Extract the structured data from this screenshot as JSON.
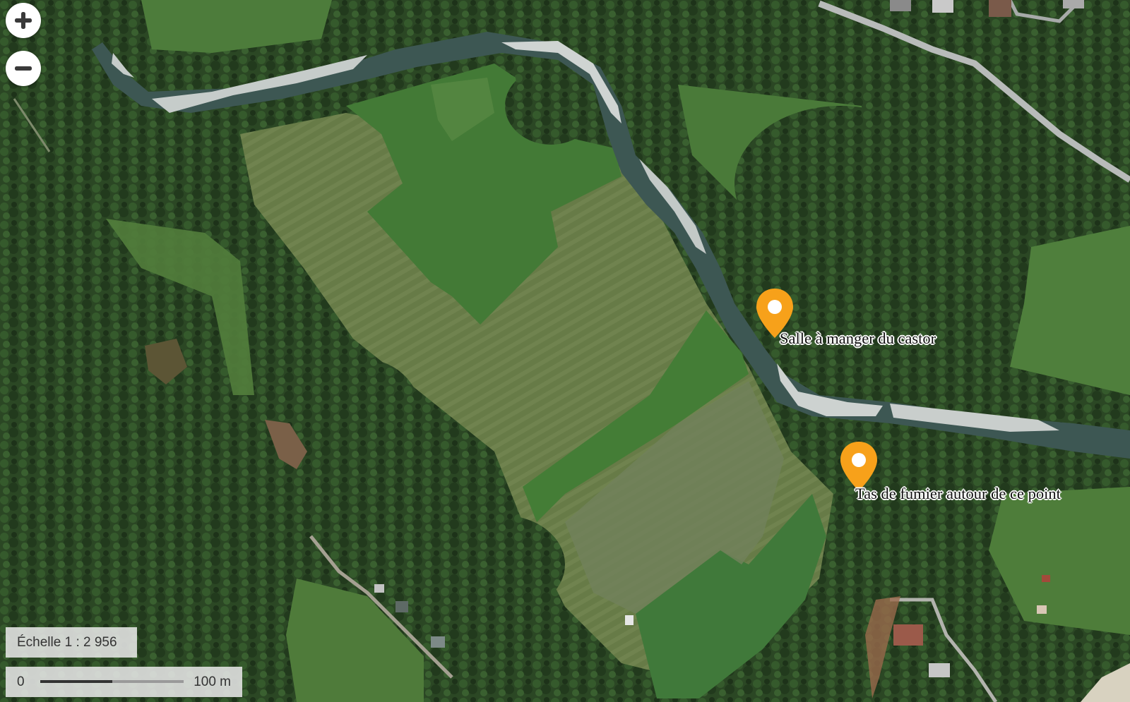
{
  "map": {
    "type": "aerial-imagery",
    "colors": {
      "forest": "#2a4423",
      "meadow": "#4b7a3b",
      "field_brown": "#6b7a4a",
      "river_water": "#3f5955",
      "gravel": "#c9cfcc",
      "road": "#b9bcbc",
      "marker": "#f7a11a"
    }
  },
  "controls": {
    "zoom_in_icon": "plus-icon",
    "zoom_out_icon": "minus-icon"
  },
  "scale": {
    "ratio_text": "Échelle 1 : 2 956",
    "zero_label": "0",
    "distance_label": "100 m"
  },
  "markers": [
    {
      "icon": "map-pin-icon",
      "label": "Salle à manger du castor"
    },
    {
      "icon": "map-pin-icon",
      "label": "Tas de fumier autour de ce point"
    }
  ]
}
